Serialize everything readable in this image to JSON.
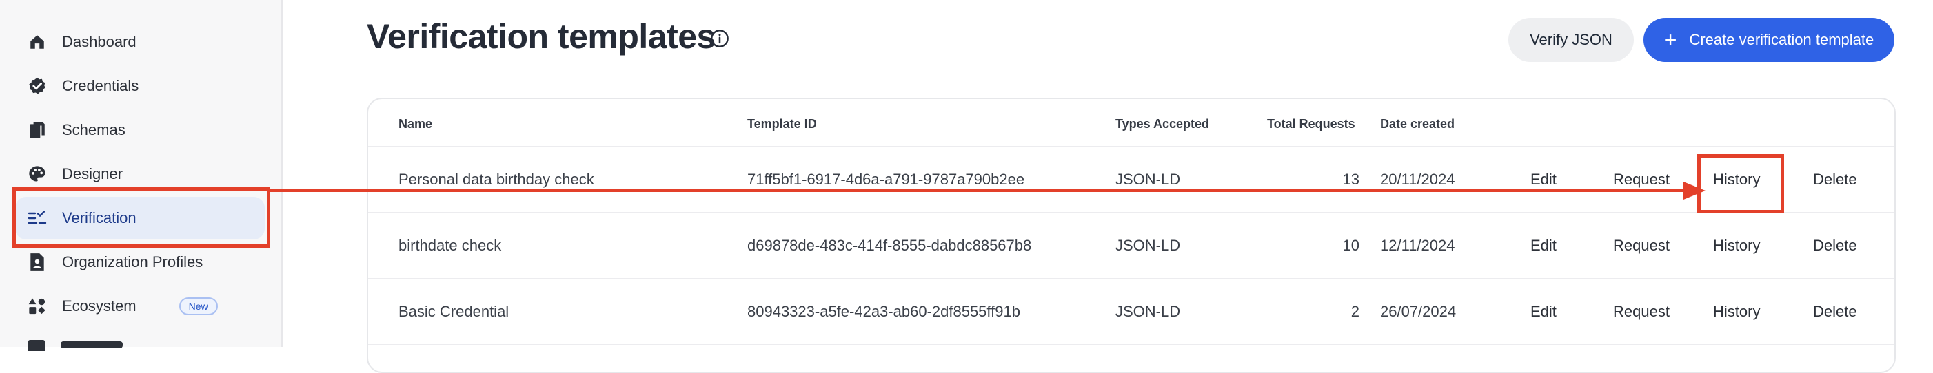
{
  "sidebar": {
    "items": [
      {
        "label": "Dashboard",
        "icon": "home-icon"
      },
      {
        "label": "Credentials",
        "icon": "badge-check-icon"
      },
      {
        "label": "Schemas",
        "icon": "documents-icon"
      },
      {
        "label": "Designer",
        "icon": "palette-icon"
      },
      {
        "label": "Verification",
        "icon": "list-check-icon",
        "active": true
      },
      {
        "label": "Organization Profiles",
        "icon": "id-document-icon"
      },
      {
        "label": "Ecosystem",
        "icon": "shapes-icon",
        "badge": "New"
      }
    ]
  },
  "header": {
    "title": "Verification templates",
    "verify_json_label": "Verify JSON",
    "create_label": "Create verification template"
  },
  "table": {
    "columns": [
      "Name",
      "Template ID",
      "Types Accepted",
      "Total Requests",
      "Date created"
    ],
    "actions": [
      "Edit",
      "Request",
      "History",
      "Delete"
    ],
    "rows": [
      {
        "name": "Personal data birthday check",
        "template_id": "71ff5bf1-6917-4d6a-a791-9787a790b2ee",
        "types": "JSON-LD",
        "total": "13",
        "date": "20/11/2024"
      },
      {
        "name": "birthdate check",
        "template_id": "d69878de-483c-414f-8555-dabdc88567b8",
        "types": "JSON-LD",
        "total": "10",
        "date": "12/11/2024"
      },
      {
        "name": "Basic Credential",
        "template_id": "80943323-a5fe-42a3-ab60-2df8555ff91b",
        "types": "JSON-LD",
        "total": "2",
        "date": "26/07/2024"
      }
    ]
  },
  "colors": {
    "accent": "#2f62e6",
    "annotation": "#e3402a",
    "active_bg": "#e6ecf8"
  }
}
